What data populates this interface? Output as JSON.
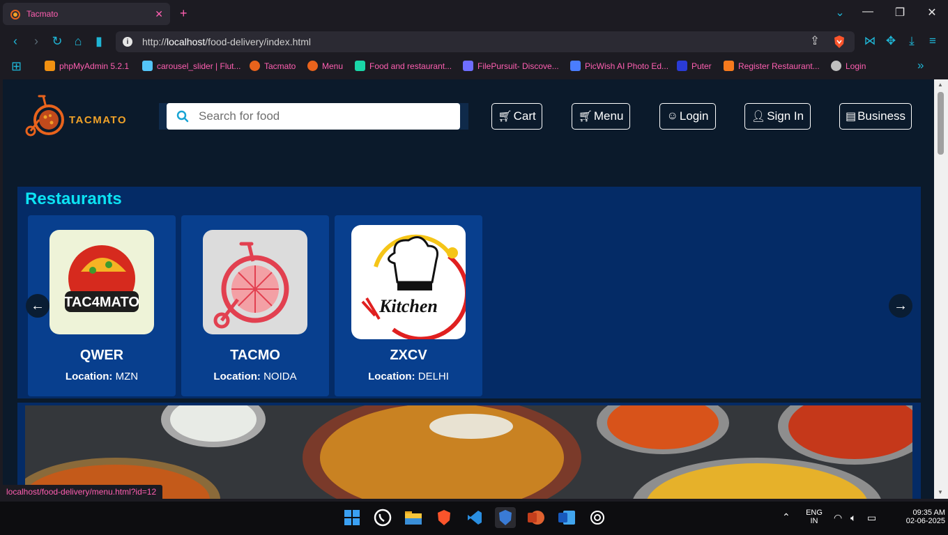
{
  "browser": {
    "tab_title": "Tacmato",
    "tab_close": "✕",
    "new_tab": "+",
    "url_prefix": "http://",
    "url_host": "localhost",
    "url_path": "/food-delivery/index.html",
    "bookmarks": [
      {
        "label": "phpMyAdmin 5.2.1",
        "color": "#f29111"
      },
      {
        "label": "carousel_slider | Flut...",
        "color": "#54c5f8"
      },
      {
        "label": "Tacmato",
        "color": "#e8631c"
      },
      {
        "label": "Menu",
        "color": "#e8631c"
      },
      {
        "label": "Food and restaurant...",
        "color": "#1ad6a8"
      },
      {
        "label": "FilePursuit- Discove...",
        "color": "#6e6eff"
      },
      {
        "label": "PicWish AI Photo Ed...",
        "color": "#4a7dff"
      },
      {
        "label": "Puter",
        "color": "#2a3bd6"
      },
      {
        "label": "Register Restaurant...",
        "color": "#f77a1d"
      },
      {
        "label": "Login",
        "color": "#bfbfbf"
      }
    ],
    "status_url": "localhost/food-delivery/menu.html?id=12"
  },
  "header": {
    "logo_text": "TACMATO",
    "search_placeholder": "Search for food",
    "buttons": {
      "cart": "Cart",
      "menu": "Menu",
      "login": "Login",
      "signin": "Sign In",
      "business": "Business"
    }
  },
  "restaurants": {
    "title": "Restaurants",
    "location_label": "Location:",
    "prev": "←",
    "next": "→",
    "items": [
      {
        "name": "QWER",
        "location": "MZN"
      },
      {
        "name": "TACMO",
        "location": "NOIDA"
      },
      {
        "name": "ZXCV",
        "location": "DELHI"
      }
    ]
  },
  "taskbar": {
    "lang_top": "ENG",
    "lang_bottom": "IN",
    "time": "09:35 AM",
    "date": "02-06-2025"
  }
}
